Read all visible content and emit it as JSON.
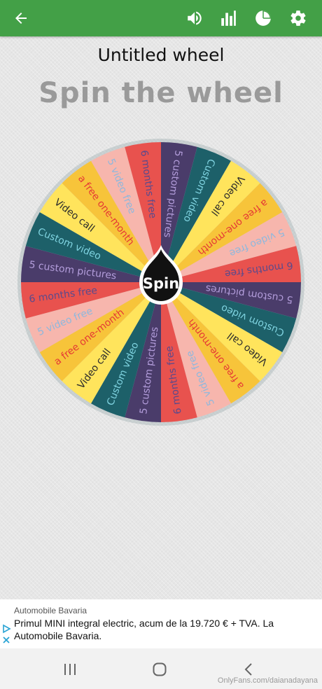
{
  "header": {
    "back_icon": "arrow-left-icon",
    "actions": [
      "volume-icon",
      "bar-chart-icon",
      "pie-chart-icon",
      "gear-icon"
    ]
  },
  "wheel_title": "Untitled wheel",
  "heading": "Spin the wheel",
  "spin_label": "Spin",
  "wheel": {
    "segments": [
      {
        "label": "5 custom pictures",
        "color": "#4a3c6a",
        "text": "#b39ddb"
      },
      {
        "label": "Custom video",
        "color": "#1d6069",
        "text": "#7fd3e0"
      },
      {
        "label": "Video call",
        "color": "#ffe45c",
        "text": "#2b2b2b"
      },
      {
        "label": "a free one-month",
        "color": "#f7c43a",
        "text": "#e53935"
      },
      {
        "label": "5 video free",
        "color": "#f7b6ad",
        "text": "#8fb8dd"
      },
      {
        "label": "6 months free",
        "color": "#e8524e",
        "text": "#5a4a8c"
      },
      {
        "label": "5 custom pictures",
        "color": "#4a3c6a",
        "text": "#b39ddb"
      },
      {
        "label": "Custom video",
        "color": "#1d6069",
        "text": "#7fd3e0"
      },
      {
        "label": "Video call",
        "color": "#ffe45c",
        "text": "#2b2b2b"
      },
      {
        "label": "a free one-month",
        "color": "#f7c43a",
        "text": "#e53935"
      },
      {
        "label": "5 video free",
        "color": "#f7b6ad",
        "text": "#8fb8dd"
      },
      {
        "label": "6 months free",
        "color": "#e8524e",
        "text": "#5a4a8c"
      },
      {
        "label": "5 custom pictures",
        "color": "#4a3c6a",
        "text": "#b39ddb"
      },
      {
        "label": "Custom video",
        "color": "#1d6069",
        "text": "#7fd3e0"
      },
      {
        "label": "Video call",
        "color": "#ffe45c",
        "text": "#2b2b2b"
      },
      {
        "label": "a free one-month",
        "color": "#f7c43a",
        "text": "#e53935"
      },
      {
        "label": "5 video free",
        "color": "#f7b6ad",
        "text": "#8fb8dd"
      },
      {
        "label": "6 months free",
        "color": "#e8524e",
        "text": "#5a4a8c"
      },
      {
        "label": "5 custom pictures",
        "color": "#4a3c6a",
        "text": "#b39ddb"
      },
      {
        "label": "Custom video",
        "color": "#1d6069",
        "text": "#7fd3e0"
      },
      {
        "label": "Video call",
        "color": "#ffe45c",
        "text": "#2b2b2b"
      },
      {
        "label": "a free one-month",
        "color": "#f7c43a",
        "text": "#e53935"
      },
      {
        "label": "5 video free",
        "color": "#f7b6ad",
        "text": "#8fb8dd"
      },
      {
        "label": "6 months free",
        "color": "#e8524e",
        "text": "#5a4a8c"
      }
    ]
  },
  "ad": {
    "advertiser": "Automobile Bavaria",
    "text": "Primul MINI integral electric, acum de la 19.720 € + TVA. La Automobile Bavaria."
  },
  "navbar": {
    "icons": [
      "recent-apps-icon",
      "home-icon",
      "back-icon"
    ]
  },
  "watermark": "OnlyFans.com/daianadayana",
  "colors": {
    "appbar": "#43a047",
    "spin_button": "#111111"
  }
}
